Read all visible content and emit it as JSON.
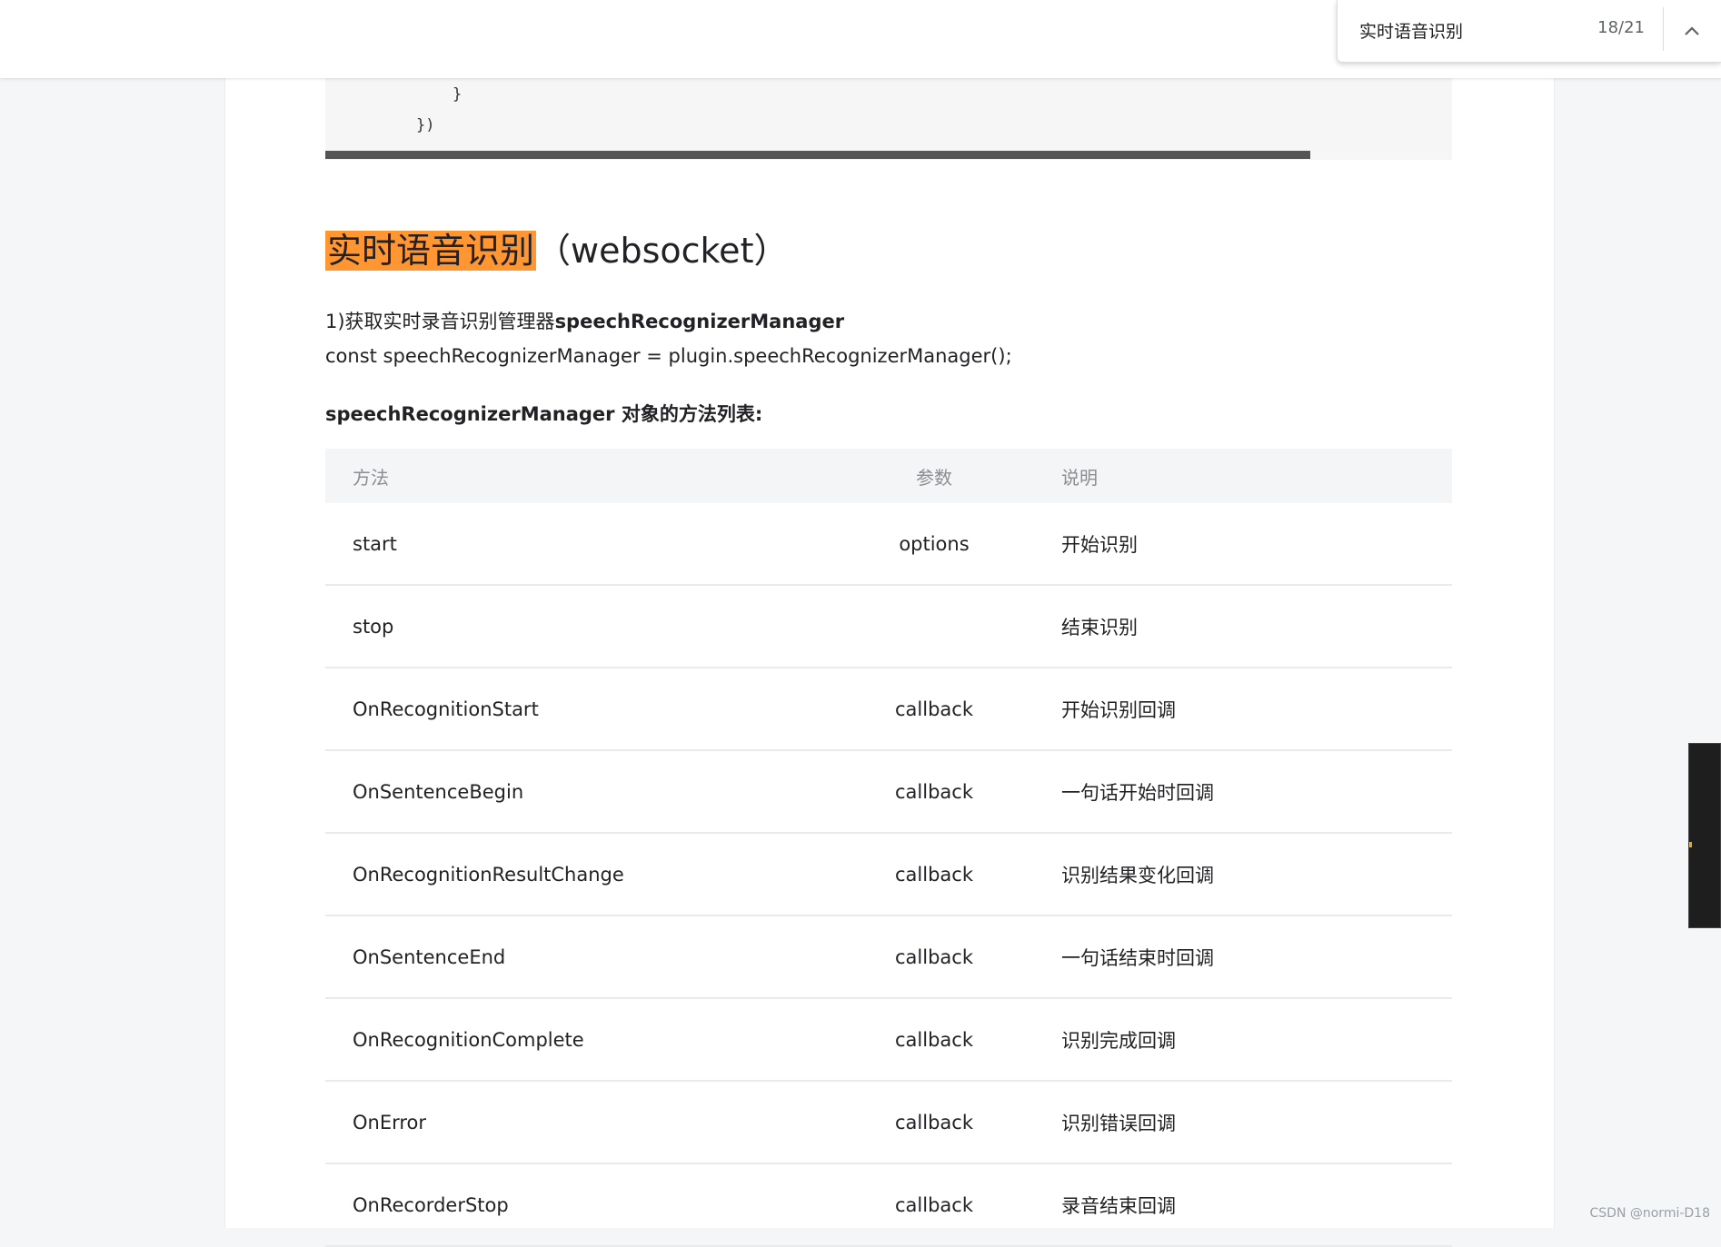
{
  "find_bar": {
    "query": "实时语音识别",
    "count": "18/21"
  },
  "code": {
    "line1": "}",
    "line2": "})"
  },
  "article": {
    "heading_highlight": "实时语音识别",
    "heading_rest": "（websocket）",
    "step1_prefix": "1)获取实时录音识别管理器",
    "step1_bold": "speechRecognizerManager",
    "code_line": "const speechRecognizerManager = plugin.speechRecognizerManager();",
    "methods_title": "speechRecognizerManager 对象的方法列表:"
  },
  "table": {
    "headers": [
      "方法",
      "参数",
      "说明"
    ],
    "rows": [
      {
        "method": "start",
        "param": "options",
        "desc": "开始识别"
      },
      {
        "method": "stop",
        "param": "",
        "desc": "结束识别"
      },
      {
        "method": "OnRecognitionStart",
        "param": "callback",
        "desc": "开始识别回调"
      },
      {
        "method": "OnSentenceBegin",
        "param": "callback",
        "desc": "一句话开始时回调"
      },
      {
        "method": "OnRecognitionResultChange",
        "param": "callback",
        "desc": "识别结果变化回调"
      },
      {
        "method": "OnSentenceEnd",
        "param": "callback",
        "desc": "一句话结束时回调"
      },
      {
        "method": "OnRecognitionComplete",
        "param": "callback",
        "desc": "识别完成回调"
      },
      {
        "method": "OnError",
        "param": "callback",
        "desc": "识别错误回调"
      },
      {
        "method": "OnRecorderStop",
        "param": "callback",
        "desc": "录音结束回调"
      }
    ]
  },
  "watermark": "CSDN @normi-D18",
  "colors": {
    "highlight": "#ff9632",
    "page_bg": "#f5f6f7",
    "content_bg": "#ffffff"
  }
}
